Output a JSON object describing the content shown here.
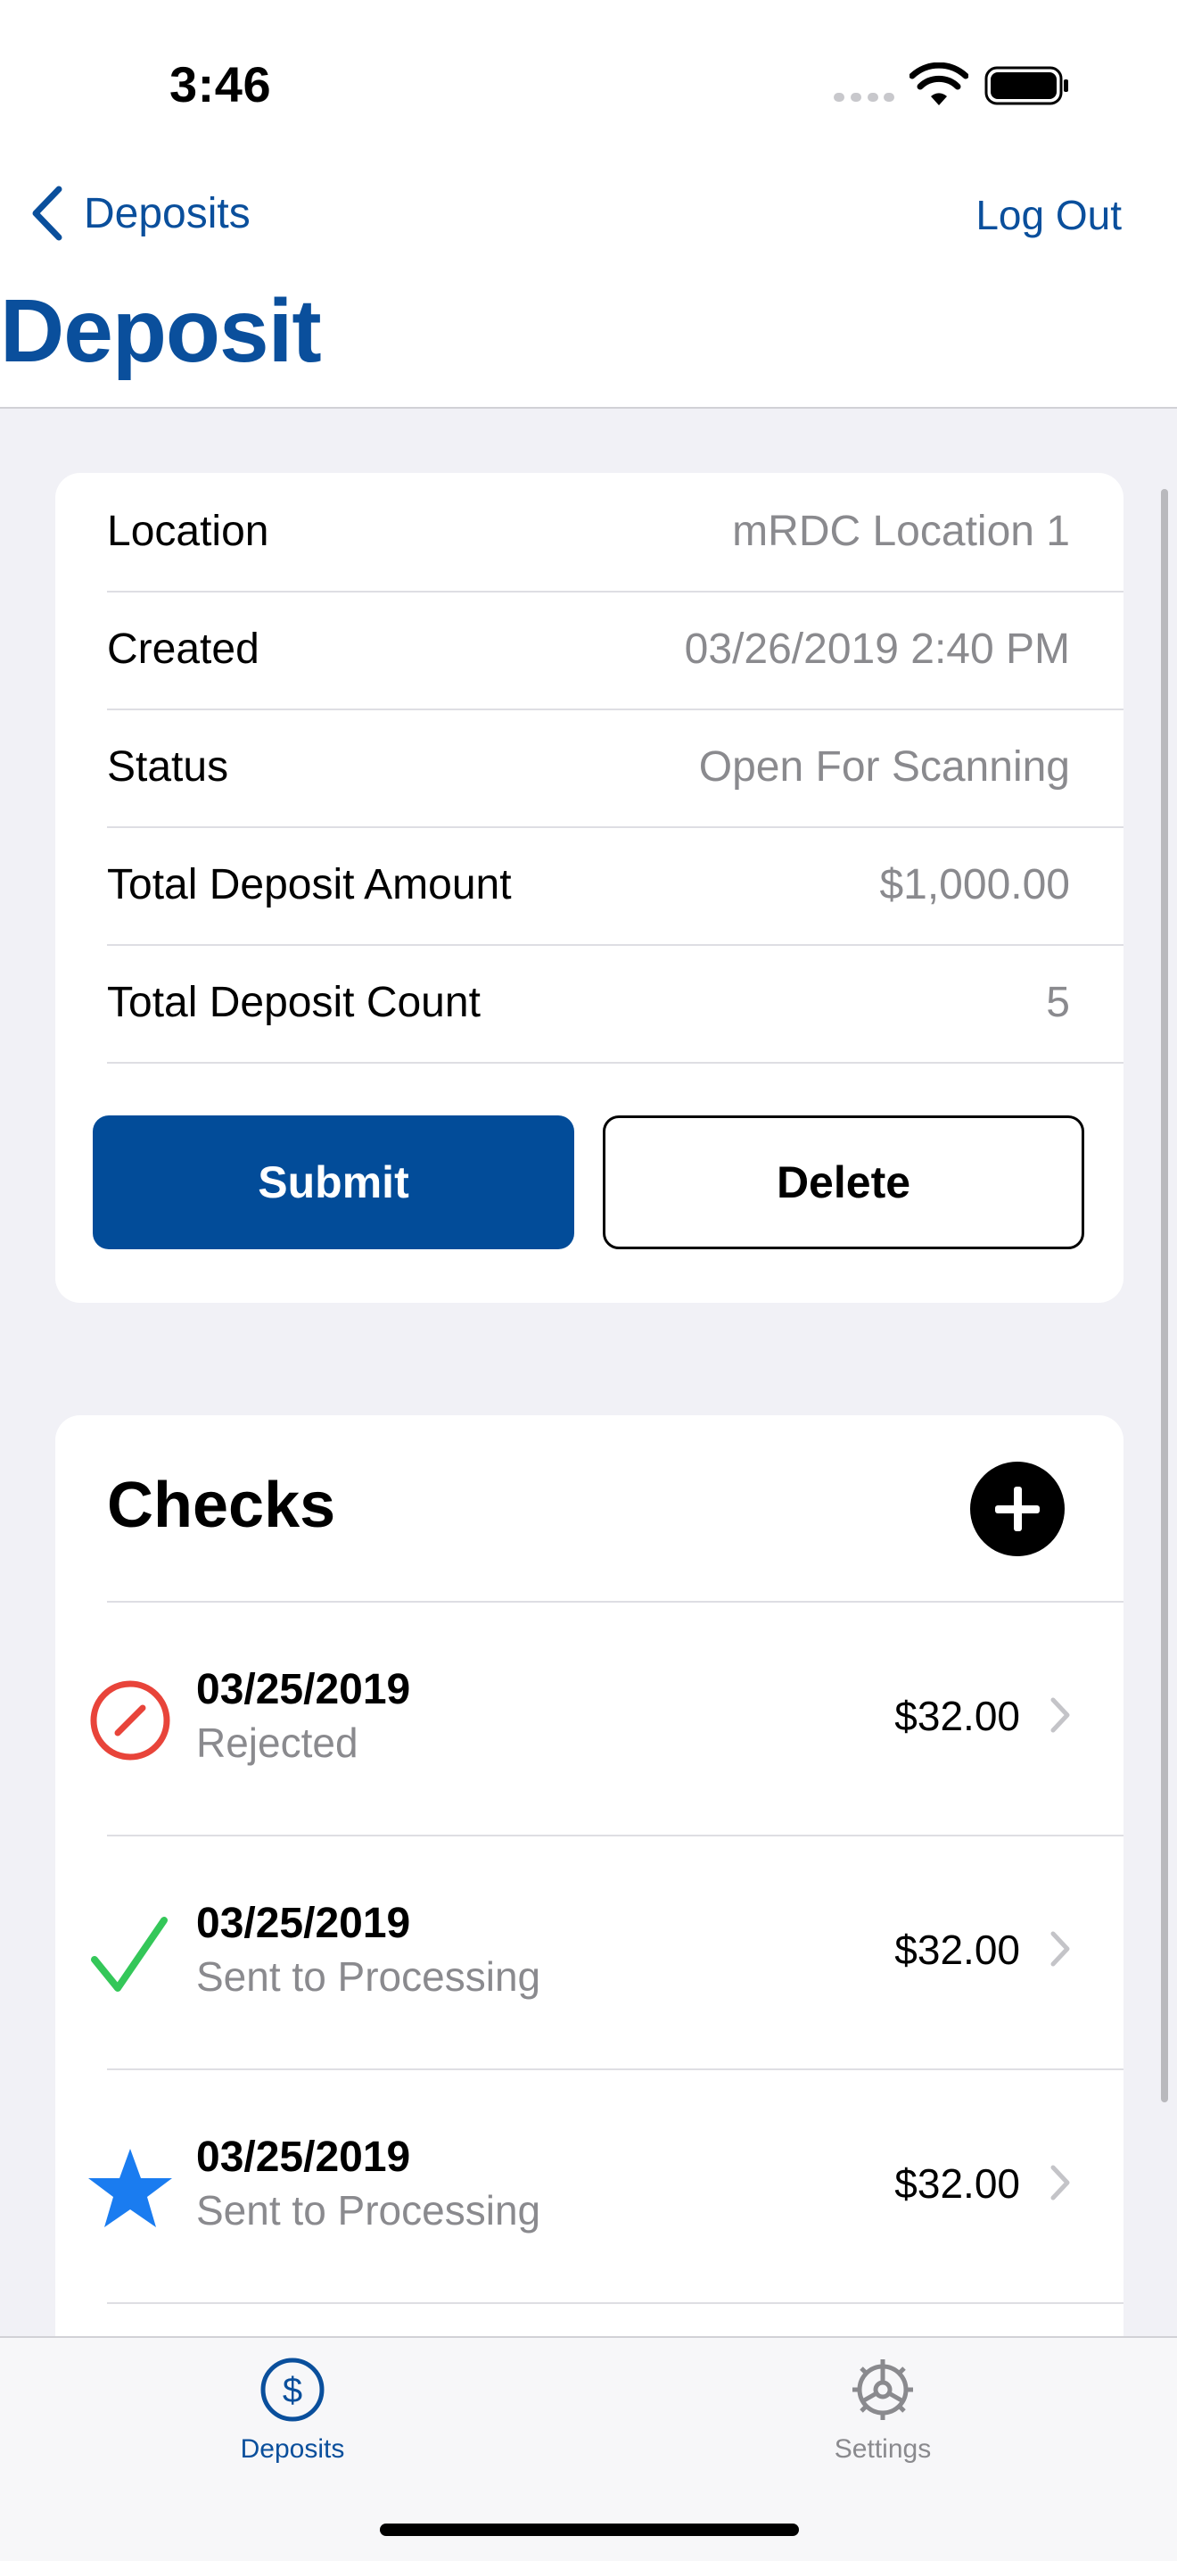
{
  "status_bar": {
    "time": "3:46"
  },
  "nav": {
    "back_label": "Deposits",
    "logout_label": "Log Out",
    "title": "Deposit"
  },
  "details": [
    {
      "label": "Location",
      "value": "mRDC Location 1"
    },
    {
      "label": "Created",
      "value": "03/26/2019 2:40 PM"
    },
    {
      "label": "Status",
      "value": "Open For Scanning"
    },
    {
      "label": "Total Deposit Amount",
      "value": "$1,000.00"
    },
    {
      "label": "Total Deposit Count",
      "value": "5"
    }
  ],
  "actions": {
    "submit_label": "Submit",
    "delete_label": "Delete"
  },
  "checks": {
    "title": "Checks",
    "items": [
      {
        "date": "03/25/2019",
        "status": "Rejected",
        "amount": "$32.00",
        "icon": "rejected-icon"
      },
      {
        "date": "03/25/2019",
        "status": "Sent to Processing",
        "amount": "$32.00",
        "icon": "checkmark-icon"
      },
      {
        "date": "03/25/2019",
        "status": "Sent to Processing",
        "amount": "$32.00",
        "icon": "star-icon"
      }
    ]
  },
  "tabs": [
    {
      "label": "Deposits",
      "icon": "dollar-circle-icon",
      "selected": true
    },
    {
      "label": "Settings",
      "icon": "gear-icon",
      "selected": false
    }
  ],
  "colors": {
    "brand": "#0a4f9c",
    "submit": "#024c99",
    "rejected": "#e8443a",
    "success": "#34c759",
    "star": "#1a7cf0"
  }
}
